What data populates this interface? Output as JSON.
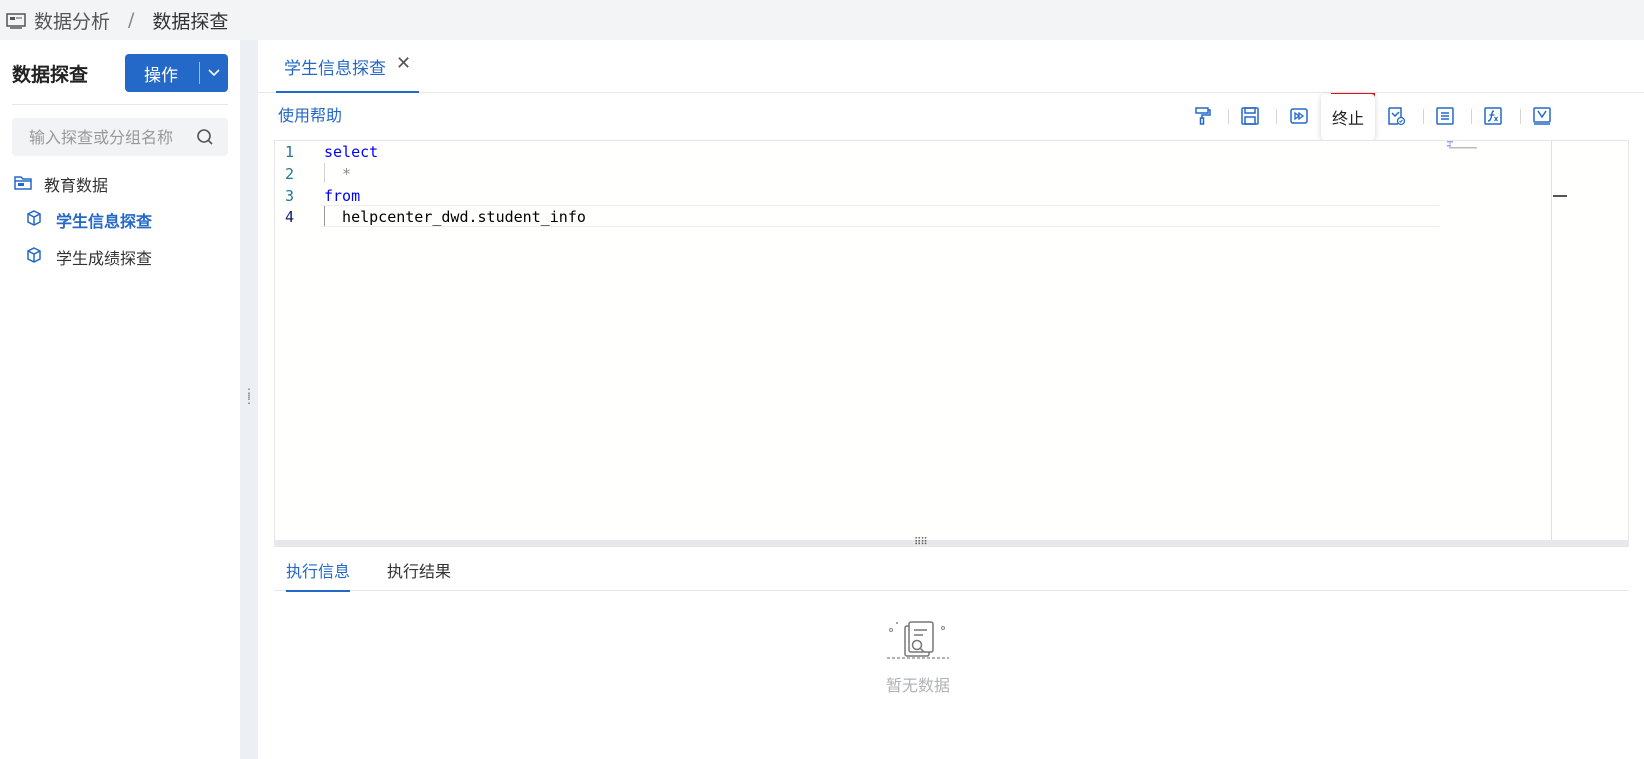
{
  "breadcrumb": {
    "root": "数据分析",
    "separator": "/",
    "current": "数据探查"
  },
  "sidebar": {
    "title": "数据探查",
    "ops_button": "操作",
    "search_placeholder": "输入探查或分组名称",
    "group": "教育数据",
    "items": [
      {
        "label": "学生信息探查",
        "active": true
      },
      {
        "label": "学生成绩探查",
        "active": false
      }
    ]
  },
  "tab": {
    "label": "学生信息探查",
    "close": "✕"
  },
  "help_link": "使用帮助",
  "toolbar": {
    "tooltip": "终止",
    "icons": [
      "format-brush-icon",
      "save-icon",
      "run-icon",
      "stop-icon",
      "check-icon",
      "list-icon",
      "function-icon",
      "download-icon"
    ],
    "highlighted": "stop-icon"
  },
  "editor": {
    "line_numbers": [
      "1",
      "2",
      "3",
      "4"
    ],
    "lines": [
      "select",
      "  *",
      "from",
      "  helpcenter_dwd.student_info"
    ]
  },
  "result_tabs": {
    "info": "执行信息",
    "result": "执行结果",
    "active": "执行信息"
  },
  "empty_text": "暂无数据",
  "colors": {
    "accent": "#2468c8",
    "highlight_border": "#e81818"
  }
}
